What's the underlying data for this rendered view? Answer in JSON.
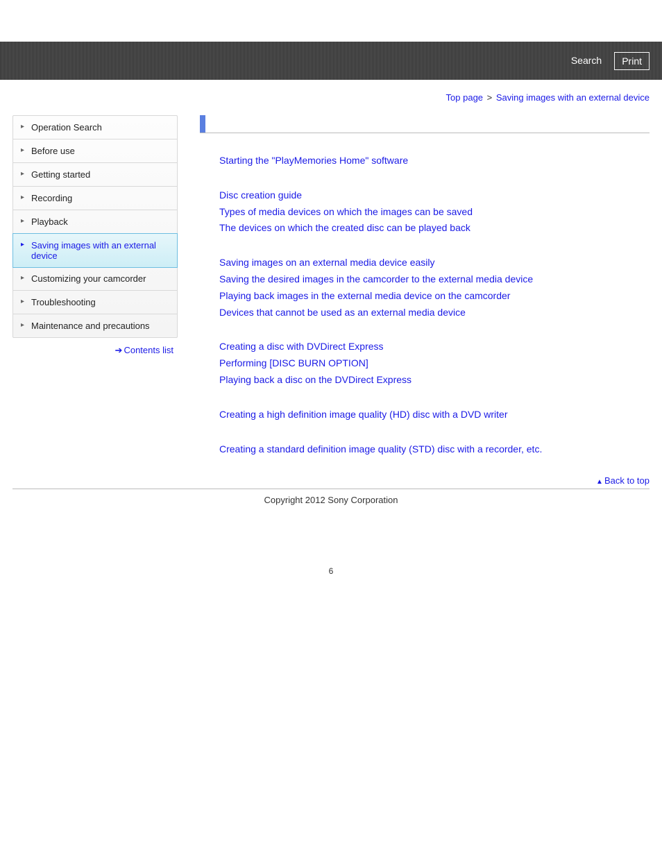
{
  "header": {
    "search_label": "Search",
    "print_label": "Print"
  },
  "breadcrumb": {
    "top_page": "Top page",
    "sep": ">",
    "current": "Saving images with an external device"
  },
  "sidebar": {
    "items": [
      {
        "label": "Operation Search",
        "active": false
      },
      {
        "label": "Before use",
        "active": false
      },
      {
        "label": "Getting started",
        "active": false
      },
      {
        "label": "Recording",
        "active": false
      },
      {
        "label": "Playback",
        "active": false
      },
      {
        "label": "Saving images with an external device",
        "active": true
      },
      {
        "label": "Customizing your camcorder",
        "active": false
      },
      {
        "label": "Troubleshooting",
        "active": false
      },
      {
        "label": "Maintenance and precautions",
        "active": false
      }
    ],
    "contents_list": "Contents list"
  },
  "main": {
    "groups": [
      {
        "links": [
          "Starting the \"PlayMemories Home\" software"
        ]
      },
      {
        "links": [
          "Disc creation guide",
          "Types of media devices on which the images can be saved",
          "The devices on which the created disc can be played back"
        ]
      },
      {
        "links": [
          "Saving images on an external media device easily",
          "Saving the desired images in the camcorder to the external media device",
          "Playing back images in the external media device on the camcorder",
          "Devices that cannot be used as an external media device"
        ]
      },
      {
        "links": [
          "Creating a disc with DVDirect Express",
          "Performing [DISC BURN OPTION]",
          "Playing back a disc on the DVDirect Express"
        ]
      },
      {
        "links": [
          "Creating a high definition image quality (HD) disc with a DVD writer"
        ]
      },
      {
        "links": [
          "Creating a standard definition image quality (STD) disc with a recorder, etc."
        ]
      }
    ],
    "back_to_top": "Back to top"
  },
  "footer": {
    "copyright": "Copyright 2012 Sony Corporation"
  },
  "page_number": "6"
}
